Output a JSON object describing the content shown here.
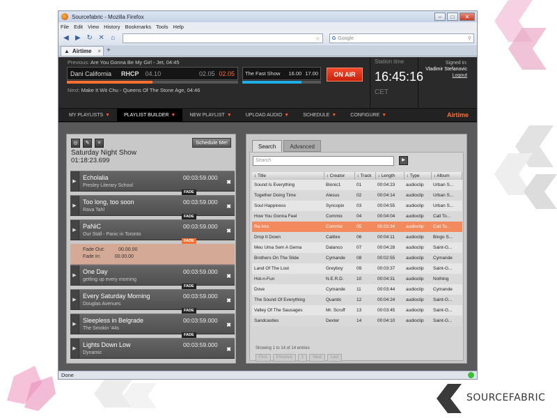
{
  "browser": {
    "window_title": "Sourcefabric - Mozilla Firefox",
    "menu": [
      "File",
      "Edit",
      "View",
      "History",
      "Bookmarks",
      "Tools",
      "Help"
    ],
    "search_placeholder": "Google",
    "tab_label": "Airtime",
    "status": "Done"
  },
  "header": {
    "previous_label": "Previous:",
    "previous_value": "Are You Gonna Be My Girl - Jet, 04:45",
    "now_title": "Dani California",
    "now_artist": "RHCP",
    "now_length": "04.10",
    "now_elapsed": "02.05",
    "now_remaining": "02.05",
    "now_progress": 0.5,
    "show_name": "The Fast Show",
    "show_start": "16.00",
    "show_end": "17.00",
    "show_progress": 0.75,
    "on_air": "ON AIR",
    "next_label": "Next:",
    "next_value": "Make It Wit Chu - Queens Of The Stone Age, 04:46",
    "station_time_label": "Station time",
    "station_time": "16:45:16",
    "timezone": "CET",
    "signed_in_label": "Signed in:",
    "user": "Vladimir Stefanovic",
    "logout": "Logout"
  },
  "nav": {
    "items": [
      "MY PLAYLISTS",
      "PLAYLIST BUILDER",
      "NEW PLAYLIST",
      "UPLOAD AUDIO",
      "SCHEDULE",
      "CONFIGURE"
    ],
    "active": "PLAYLIST BUILDER",
    "logo": "Airtime"
  },
  "playlist": {
    "schedule_button": "Schedule Me!",
    "name": "Saturday Night Show",
    "length": "01:18:23.699",
    "fade_label": "FADE",
    "fade_out_label": "Fade Out:",
    "fade_out_value": "00.00.00",
    "fade_in_label": "Fade In:",
    "fade_in_value": "00.00.00",
    "items": [
      {
        "title": "Echolalia",
        "artist": "Presley Literary School",
        "length": "00:03:59.000"
      },
      {
        "title": "Too long, too soon",
        "artist": "Rava Tahl",
        "length": "00:03:59.000"
      },
      {
        "title": "PaNiC",
        "artist": "Our Stall - Panic in Toronto",
        "length": "00:03:59.000"
      },
      {
        "title": "One Day",
        "artist": "getting up every morning",
        "length": "00:03:59.000"
      },
      {
        "title": "Every Saturday Morning",
        "artist": "Douglas Avenues",
        "length": "00:03:59.000"
      },
      {
        "title": "Sleepless in Belgrade",
        "artist": "The Smokin '44s",
        "length": "00:03:59.000"
      },
      {
        "title": "Lights Down Low",
        "artist": "Dynamic",
        "length": "00:03:59.000"
      }
    ]
  },
  "library": {
    "tabs": [
      "Search",
      "Advanced"
    ],
    "search_placeholder": "Search",
    "columns": [
      "Title",
      "Creator",
      "Track",
      "Length",
      "Type",
      "Album"
    ],
    "rows": [
      [
        "Sound Is Everything",
        "Bionic1",
        "01",
        "00:04:23",
        "audioclip",
        "Urban S..."
      ],
      [
        "Together Doing Time",
        "Alesus",
        "02",
        "00:04:14",
        "audioclip",
        "Urban S..."
      ],
      [
        "Soul Happiness",
        "Syncopix",
        "03",
        "00:04:55",
        "audioclip",
        "Urban S..."
      ],
      [
        "How You Gonna Feel",
        "Commix",
        "04",
        "00:04:04",
        "audioclip",
        "Call To..."
      ],
      [
        "Re-Imo",
        "Commix",
        "05",
        "00:03:34",
        "audioclip",
        "Call To..."
      ],
      [
        "Drop It Down",
        "Calibre",
        "06",
        "00:04:11",
        "audioclip",
        "Bingo S..."
      ],
      [
        "Meu Uma Sem A Gema",
        "Dalanco",
        "07",
        "00:04:28",
        "audioclip",
        "Saint-G..."
      ],
      [
        "Brothers On The Slide",
        "Cymande",
        "08",
        "00:02:55",
        "audioclip",
        "Cymande"
      ],
      [
        "Land Of The Lost",
        "Greyboy",
        "09",
        "00:03:37",
        "audioclip",
        "Saint-G..."
      ],
      [
        "Hot-n-Fun",
        "N.E.R.D.",
        "10",
        "00:04:31",
        "audioclip",
        "Nothing"
      ],
      [
        "Dove",
        "Cymande",
        "11",
        "00:03:44",
        "audioclip",
        "Cymande"
      ],
      [
        "The Sound Of Everything",
        "Quantic",
        "12",
        "00:04:24",
        "audioclip",
        "Saint-G..."
      ],
      [
        "Valley Of The Sausages",
        "Mr. Scruff",
        "13",
        "00:03:45",
        "audioclip",
        "Saint-G..."
      ],
      [
        "Sandcastles",
        "Dexter",
        "14",
        "00:04:10",
        "audioclip",
        "Saint-G..."
      ]
    ],
    "selected_row": 4,
    "showing": "Showing 1 to 14 of 14 entries",
    "pager": [
      "First",
      "Previous",
      "1",
      "Next",
      "Last"
    ]
  },
  "brand": "SOURCEFABRIC"
}
